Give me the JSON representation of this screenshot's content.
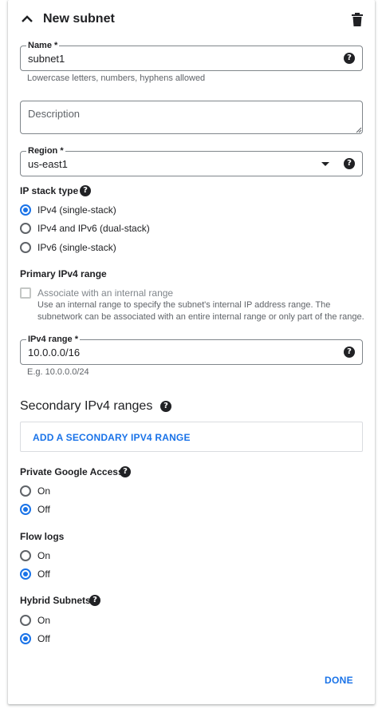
{
  "header": {
    "title": "New subnet"
  },
  "name_field": {
    "label": "Name *",
    "value": "subnet1",
    "hint": "Lowercase letters, numbers, hyphens allowed"
  },
  "description_field": {
    "placeholder": "Description"
  },
  "region_field": {
    "label": "Region *",
    "value": "us-east1"
  },
  "ip_stack": {
    "label": "IP stack type",
    "options": [
      {
        "label": "IPv4 (single-stack)",
        "selected": true
      },
      {
        "label": "IPv4 and IPv6 (dual-stack)",
        "selected": false
      },
      {
        "label": "IPv6 (single-stack)",
        "selected": false
      }
    ]
  },
  "primary_range": {
    "label": "Primary IPv4 range",
    "checkbox_label": "Associate with an internal range",
    "checkbox_desc": "Use an internal range to specify the subnet's internal IP address range. The subnetwork can be associated with an entire internal range or only part of the range."
  },
  "ipv4_field": {
    "label": "IPv4 range *",
    "value": "10.0.0.0/16",
    "hint": "E.g. 10.0.0.0/24"
  },
  "secondary": {
    "title": "Secondary IPv4 ranges",
    "add_button": "ADD A SECONDARY IPV4 RANGE"
  },
  "private_google_access": {
    "label": "Private Google Access",
    "options": [
      {
        "label": "On",
        "selected": false
      },
      {
        "label": "Off",
        "selected": true
      }
    ]
  },
  "flow_logs": {
    "label": "Flow logs",
    "options": [
      {
        "label": "On",
        "selected": false
      },
      {
        "label": "Off",
        "selected": true
      }
    ]
  },
  "hybrid_subnets": {
    "label": "Hybrid Subnets",
    "options": [
      {
        "label": "On",
        "selected": false
      },
      {
        "label": "Off",
        "selected": true
      }
    ]
  },
  "footer": {
    "done_label": "DONE"
  },
  "help_glyph": "?",
  "colors": {
    "accent": "#1a73e8",
    "text": "#202124",
    "muted": "#5f6368",
    "border": "#80868b"
  }
}
